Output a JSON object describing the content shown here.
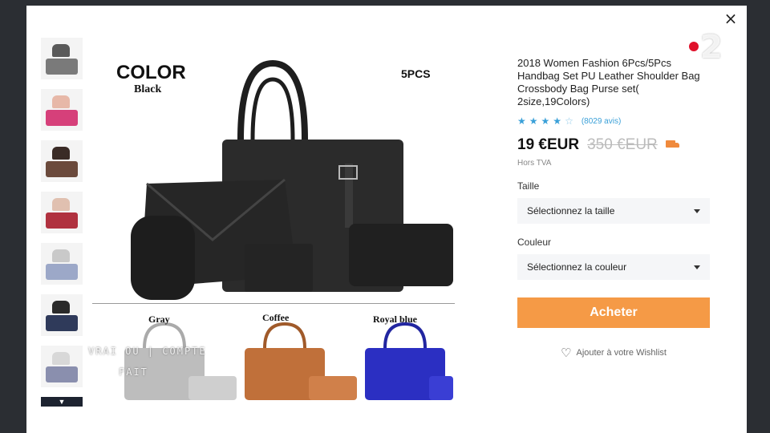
{
  "modal": {
    "close_icon": "×"
  },
  "channel_logo": {
    "number": "2"
  },
  "product": {
    "image": {
      "color_title": "COLOR",
      "color_name": "Black",
      "pcs_label": "5PCS",
      "variants": [
        "Gray",
        "Coffee",
        "Royal blue"
      ]
    },
    "title": "2018 Women Fashion 6Pcs/5Pcs Handbag Set PU Leather Shoulder Bag Crossbody Bag Purse set( 2size,19Colors)",
    "rating": {
      "stars": 3.5,
      "reviews": "(8029 avis)"
    },
    "price": "19 €EUR",
    "old_price": "350 €EUR",
    "tax": "Hors TVA",
    "size_label": "Taille",
    "size_select": "Sélectionnez la taille",
    "color_label": "Couleur",
    "color_select": "Sélectionnez la couleur",
    "buy_button": "Acheter",
    "wishlist": "Ajouter à votre Wishlist"
  },
  "thumbnails": [
    {
      "color": "#5a5a5a"
    },
    {
      "color": "#d6407a"
    },
    {
      "color": "#3a2b26"
    },
    {
      "color": "#b0313f"
    },
    {
      "color": "#c9c9c9"
    },
    {
      "color": "#2f3a5a"
    },
    {
      "color": "#8a8fae"
    }
  ],
  "watermark": {
    "line1": "VRAI OU",
    "line2": "FAIT",
    "middle": "COMPTE"
  }
}
